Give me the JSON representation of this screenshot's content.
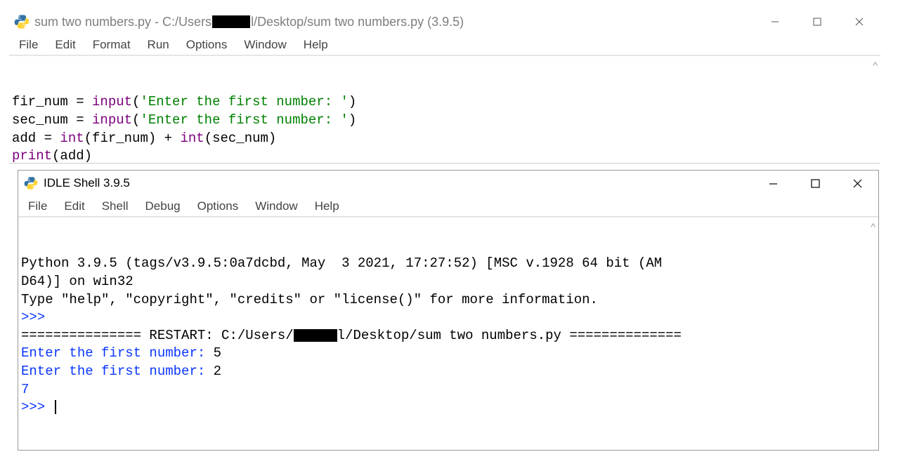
{
  "editor": {
    "title_prefix": "sum two numbers.py - C:/Users",
    "title_suffix": "l/Desktop/sum two numbers.py (3.9.5)",
    "menus": [
      "File",
      "Edit",
      "Format",
      "Run",
      "Options",
      "Window",
      "Help"
    ],
    "code": {
      "l1a": "fir_num = ",
      "l1b": "input",
      "l1c": "(",
      "l1d": "'Enter the first number: '",
      "l1e": ")",
      "l2a": "sec_num = ",
      "l2b": "input",
      "l2c": "(",
      "l2d": "'Enter the first number: '",
      "l2e": ")",
      "l3a": "add = ",
      "l3b": "int",
      "l3c": "(fir_num) + ",
      "l3d": "int",
      "l3e": "(sec_num)",
      "l4a": "print",
      "l4b": "(add)"
    }
  },
  "shell": {
    "title": "IDLE Shell 3.9.5",
    "menus": [
      "File",
      "Edit",
      "Shell",
      "Debug",
      "Options",
      "Window",
      "Help"
    ],
    "banner1": "Python 3.9.5 (tags/v3.9.5:0a7dcbd, May  3 2021, 17:27:52) [MSC v.1928 64 bit (AM",
    "banner2": "D64)] on win32",
    "banner3": "Type \"help\", \"copyright\", \"credits\" or \"license()\" for more information.",
    "prompt": ">>> ",
    "restart_left": "=============== RESTART: C:/Users/",
    "restart_right": "l/Desktop/sum two numbers.py ==============",
    "run1p": "Enter the first number: ",
    "run1v": "5",
    "run2p": "Enter the first number: ",
    "run2v": "2",
    "result": "7"
  },
  "scroll_glyph": "^"
}
